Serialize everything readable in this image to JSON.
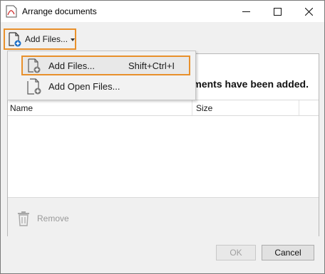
{
  "window": {
    "title": "Arrange documents",
    "controls": [
      "minimize",
      "maximize",
      "close"
    ]
  },
  "toolbar": {
    "add_files_label": "Add Files..."
  },
  "dropdown": {
    "items": [
      {
        "label": "Add Files...",
        "shortcut": "Shift+Ctrl+I",
        "state": "highlighted"
      },
      {
        "label": "Add Open Files...",
        "shortcut": ""
      }
    ]
  },
  "main": {
    "notice_text": "ments have been added.",
    "columns": [
      {
        "label": "Name"
      },
      {
        "label": "Size"
      }
    ]
  },
  "actions": {
    "remove_label": "Remove",
    "ok_label": "OK",
    "cancel_label": "Cancel"
  },
  "colors": {
    "highlight": "#e8902b",
    "accent": "#1e6fc6"
  }
}
